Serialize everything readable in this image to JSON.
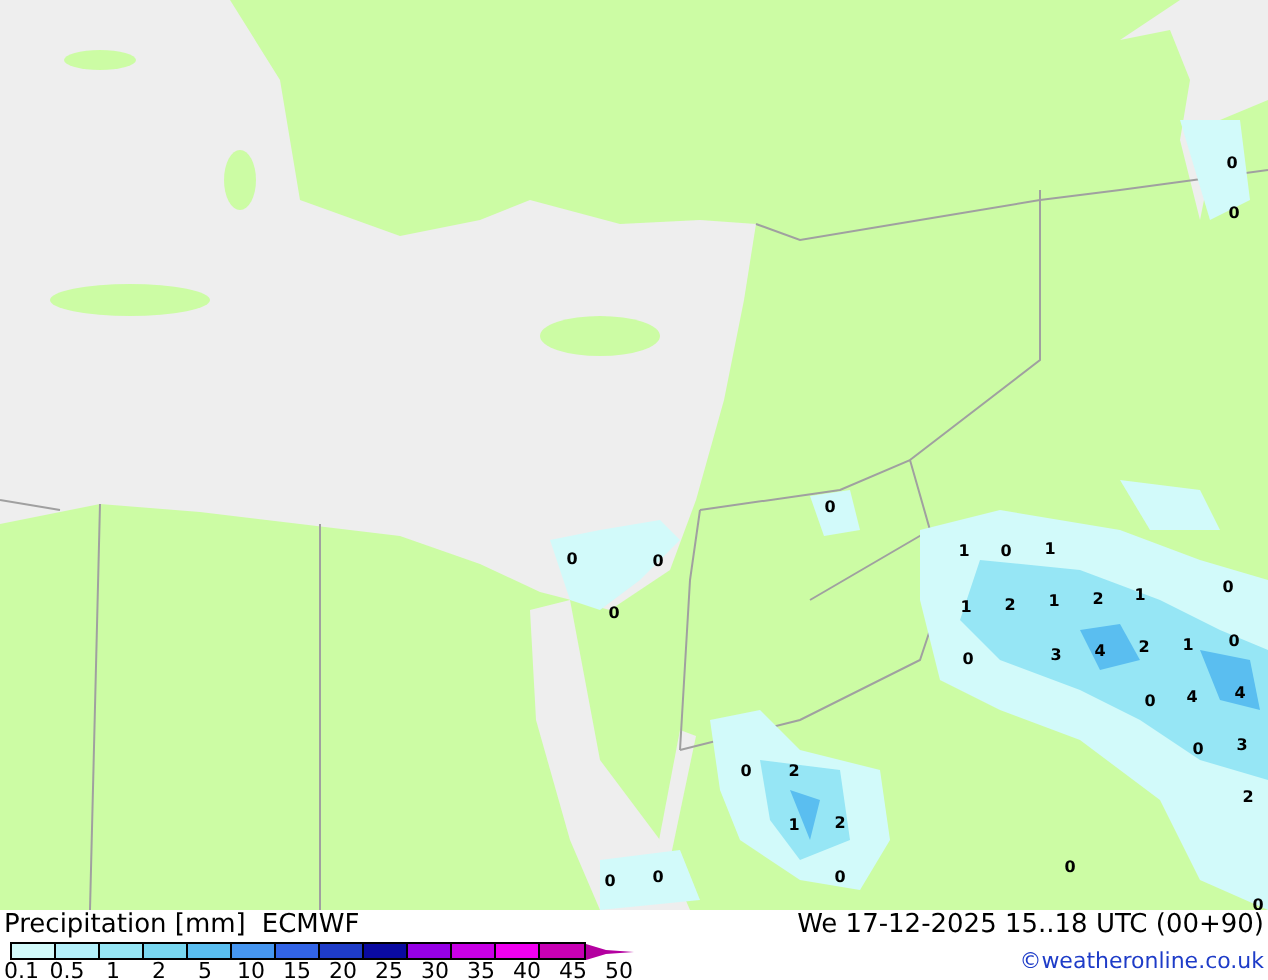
{
  "map_labels": [
    "0",
    "0",
    "1",
    "0",
    "1",
    "0",
    "1",
    "2",
    "1",
    "2",
    "1",
    "0",
    "0",
    "3",
    "4",
    "2",
    "1",
    "0",
    "4",
    "4",
    "0",
    "3",
    "2",
    "0",
    "0",
    "0",
    "0",
    "0",
    "0",
    "0",
    "2",
    "1",
    "2",
    "0",
    "0",
    "0"
  ],
  "legend": {
    "title": "Precipitation [mm]",
    "model": "ECMWF",
    "bins": [
      {
        "color": "#d2fafa"
      },
      {
        "color": "#b4f0fa"
      },
      {
        "color": "#96e6f5"
      },
      {
        "color": "#78d7f0"
      },
      {
        "color": "#5abef0"
      },
      {
        "color": "#4696f0"
      },
      {
        "color": "#3264e6"
      },
      {
        "color": "#1e3cc8"
      },
      {
        "color": "#0a0aa0"
      },
      {
        "color": "#9600e6"
      },
      {
        "color": "#c800e6"
      },
      {
        "color": "#f000f0"
      },
      {
        "color": "#c800b4"
      }
    ],
    "ticks": [
      "0.1",
      "0.5",
      "1",
      "2",
      "5",
      "10",
      "15",
      "20",
      "25",
      "30",
      "35",
      "40",
      "45",
      "50"
    ]
  },
  "valid_time": "We 17-12-2025 15..18 UTC (00+90)",
  "credit": "©weatheronline.co.uk"
}
